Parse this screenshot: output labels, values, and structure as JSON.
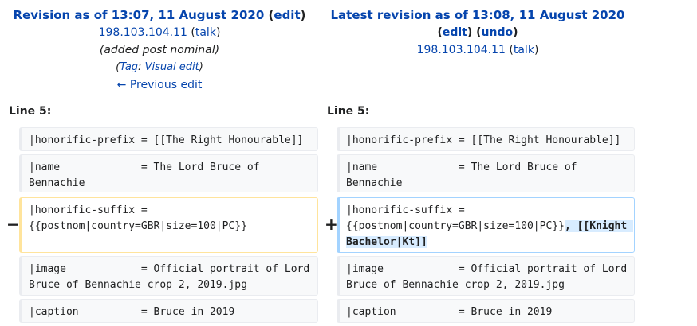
{
  "left_header": {
    "title": "Revision as of 13:07, 11 August 2020",
    "edit_label": "edit",
    "user": "198.103.104.11",
    "talk_label": "talk",
    "summary": "(added post nominal)",
    "tag_prefix": "Tag",
    "tag_name": "Visual edit",
    "previous_edit": "← Previous edit"
  },
  "right_header": {
    "title": "Latest revision as of 13:08, 11 August 2020",
    "edit_label": "edit",
    "undo_label": "undo",
    "user": "198.103.104.11",
    "talk_label": "talk"
  },
  "line_labels": {
    "left": "Line 5:",
    "right": "Line 5:"
  },
  "diff": {
    "minus_marker": "−",
    "plus_marker": "+",
    "rows": [
      {
        "left": "|honorific-prefix = [[The Right Honourable]]",
        "right": "|honorific-prefix = [[The Right Honourable]]"
      },
      {
        "left": "|name             = The Lord Bruce of Bennachie",
        "right": "|name             = The Lord Bruce of Bennachie"
      },
      {
        "left": "|honorific-suffix = {{postnom|country=GBR|size=100|PC}}",
        "right_base": "|honorific-suffix = {{postnom|country=GBR|size=100|PC}}",
        "right_inserted": ", [[Knight Bachelor|Kt]]"
      },
      {
        "left": "|image            = Official portrait of Lord Bruce of Bennachie crop 2, 2019.jpg",
        "right": "|image            = Official portrait of Lord Bruce of Bennachie crop 2, 2019.jpg"
      },
      {
        "left": "|caption          = Bruce in 2019",
        "right": "|caption          = Bruce in 2019"
      }
    ]
  }
}
